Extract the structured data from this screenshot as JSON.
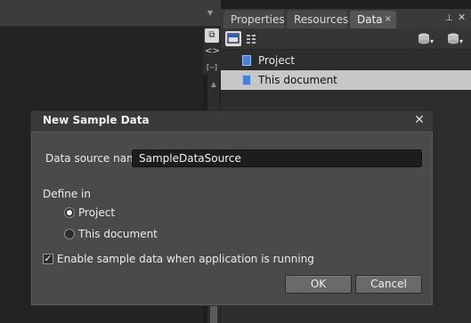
{
  "panel": {
    "tabs": [
      {
        "label": "Properties"
      },
      {
        "label": "Resources"
      },
      {
        "label": "Data",
        "close": "×"
      }
    ],
    "tree": [
      {
        "label": "Project"
      },
      {
        "label": "This document",
        "selected": true
      }
    ]
  },
  "dialog": {
    "title": "New Sample Data",
    "close_glyph": "✕",
    "data_source_label": "Data source name",
    "data_source_value": "SampleDataSource",
    "define_in_label": "Define in",
    "radio_project": "Project",
    "radio_document": "This document",
    "selected_option": "Project",
    "checkbox_label": "Enable sample data when application is running",
    "checkbox_checked": true,
    "ok_label": "OK",
    "cancel_label": "Cancel"
  },
  "colors": {
    "dialog_bg": "#4a4a4a",
    "selected_row": "#c7c7c7",
    "input_bg": "#1d1d1d"
  }
}
